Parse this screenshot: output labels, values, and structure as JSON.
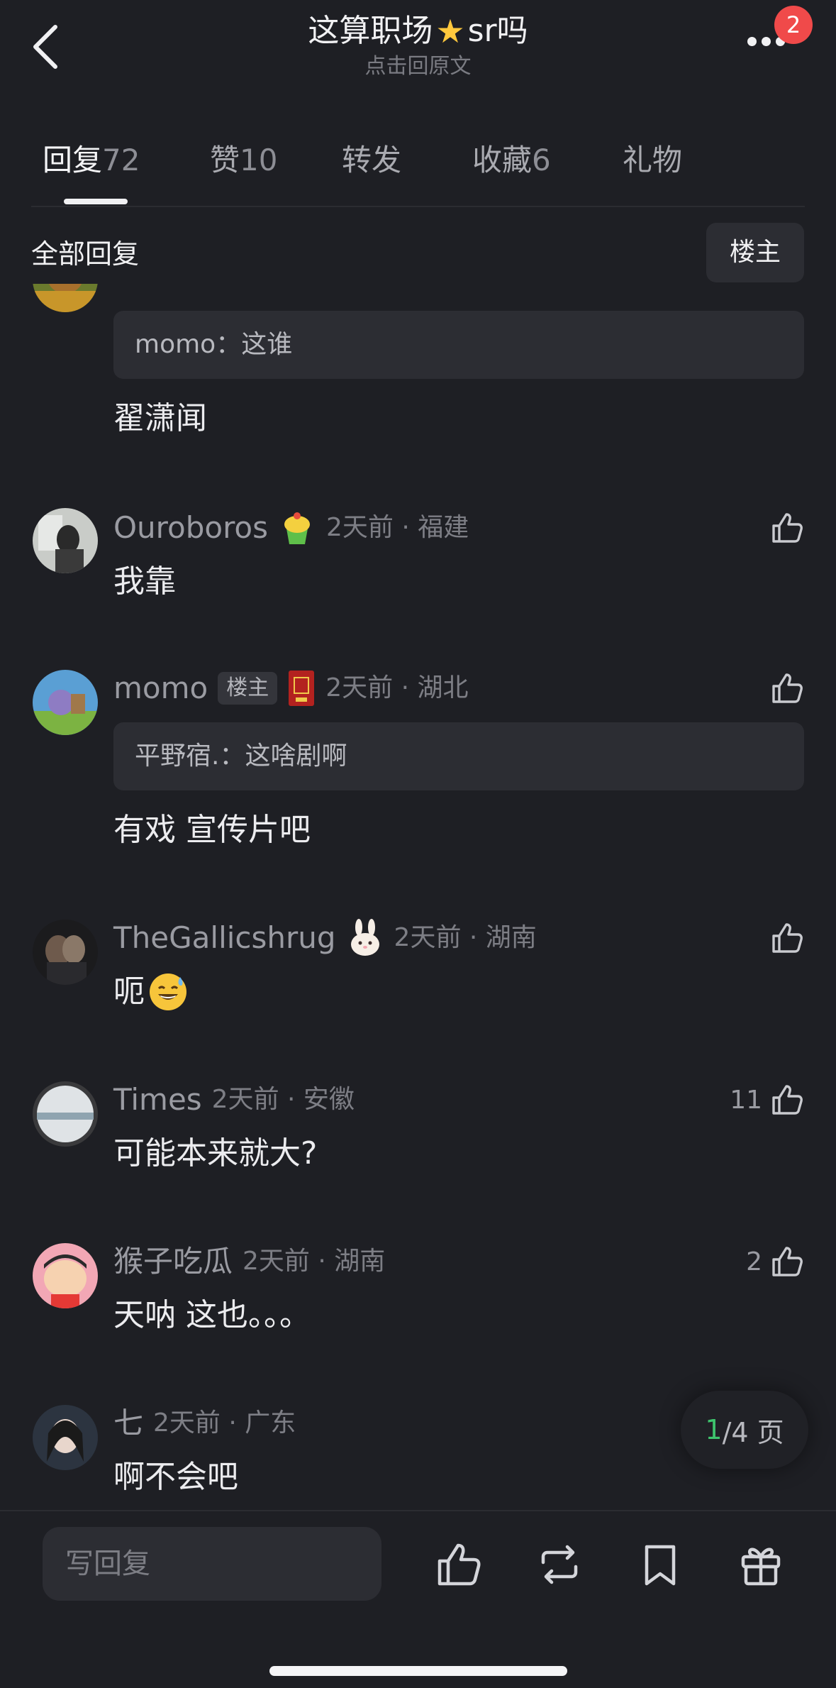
{
  "header": {
    "title_prefix": "这算职场",
    "title_suffix": "sr吗",
    "subtitle": "点击回原文",
    "notification_count": "2"
  },
  "tabs": [
    {
      "label": "回复",
      "count": "72"
    },
    {
      "label": "赞",
      "count": "10"
    },
    {
      "label": "转发",
      "count": ""
    },
    {
      "label": "收藏",
      "count": "6"
    },
    {
      "label": "礼物",
      "count": ""
    }
  ],
  "filter": {
    "label": "全部回复",
    "owner_button": "楼主"
  },
  "comments": [
    {
      "quote_user": "momo",
      "quote_sep": "：",
      "quote_text": "这谁",
      "text": "翟潇闻"
    },
    {
      "name": "Ouroboros",
      "time": "2天前 · 福建",
      "text": "我靠",
      "likes": ""
    },
    {
      "name": "momo",
      "tag": "楼主",
      "time": "2天前 · 湖北",
      "quote_user": "平野宿.",
      "quote_sep": "：",
      "quote_text": "这啥剧啊",
      "text": "有戏 宣传片吧",
      "likes": ""
    },
    {
      "name": "TheGallicshrug",
      "time": "2天前 · 湖南",
      "text": "呃",
      "likes": ""
    },
    {
      "name": "Times",
      "time": "2天前 · 安徽",
      "text": "可能本来就大?",
      "likes": "11"
    },
    {
      "name": "猴子吃瓜",
      "time": "2天前 · 湖南",
      "text": "天呐 这也。。。",
      "likes": "2"
    },
    {
      "name": "七",
      "time": "2天前 · 广东",
      "text": "啊不会吧",
      "likes": ""
    }
  ],
  "pager": {
    "current": "1",
    "rest": "/4 页"
  },
  "bottom": {
    "reply_placeholder": "写回复"
  },
  "colors": {
    "accent_green": "#3ec46d",
    "badge_red": "#f04a4a",
    "background": "#1e1f24"
  }
}
